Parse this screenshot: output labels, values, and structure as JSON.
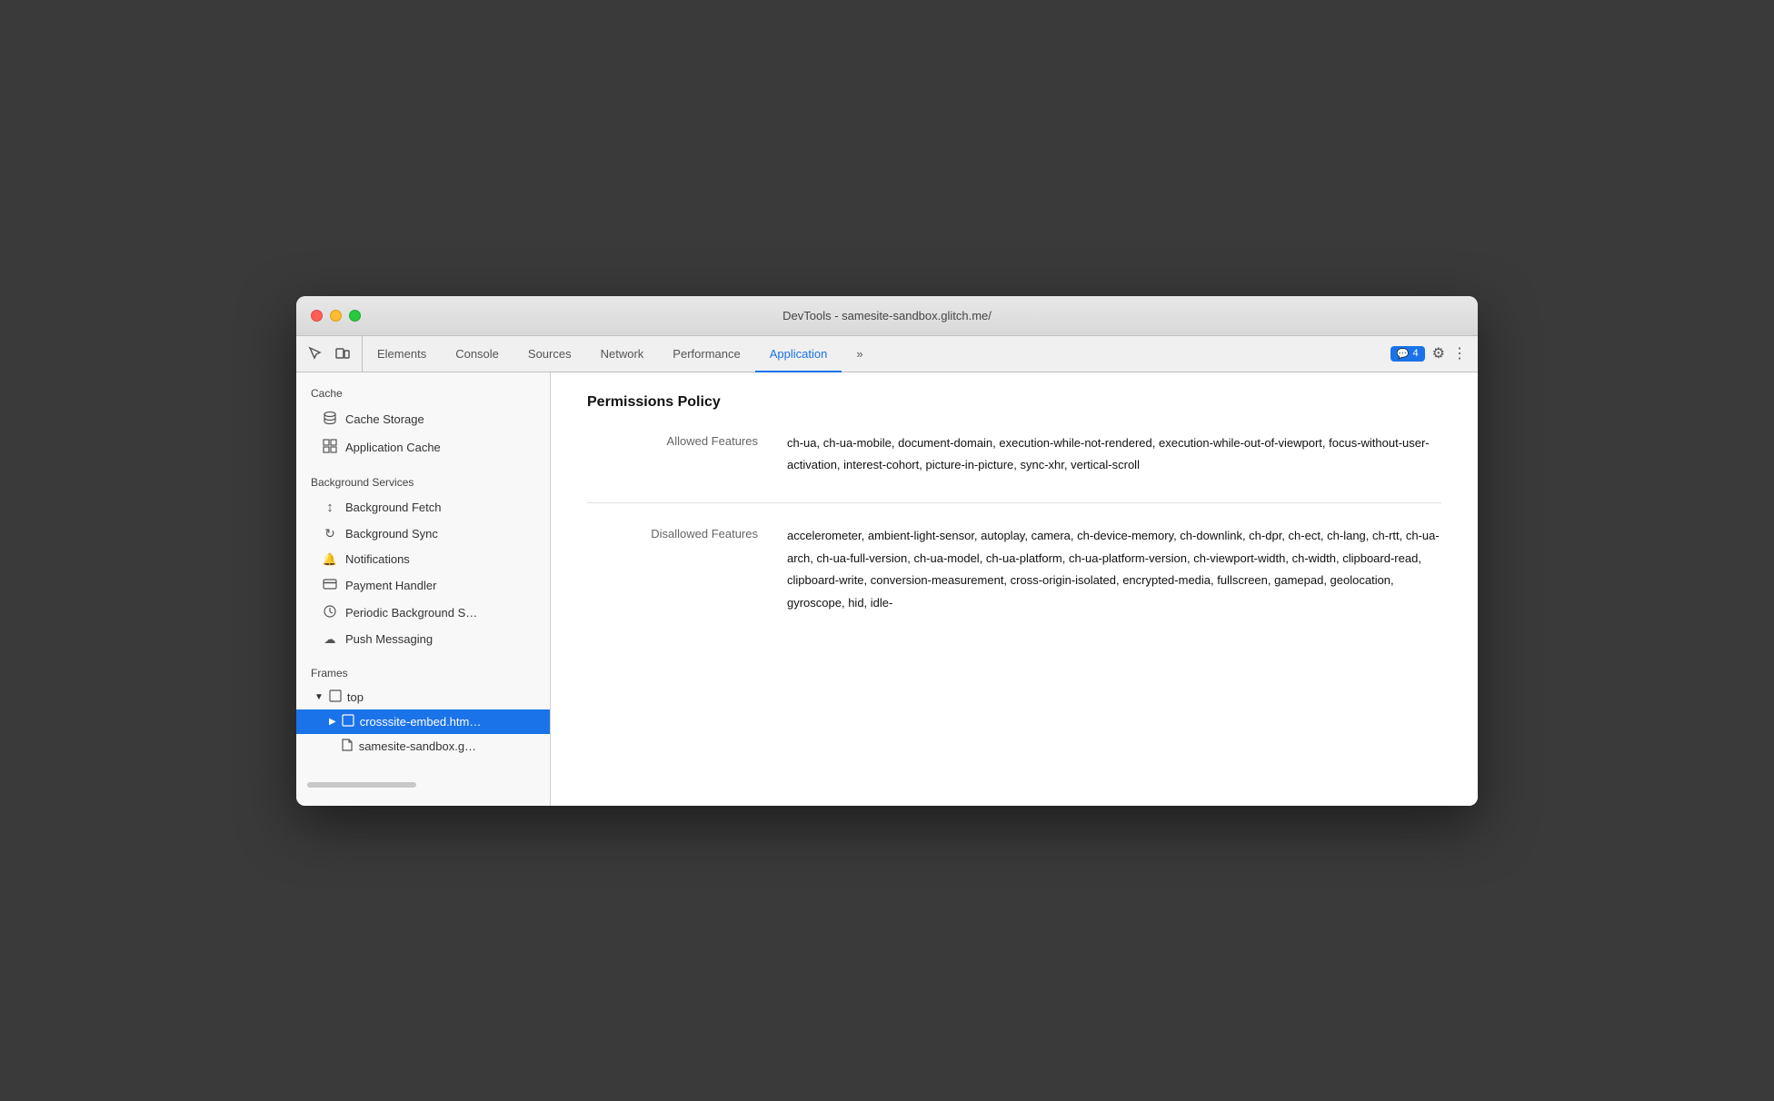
{
  "window": {
    "title": "DevTools - samesite-sandbox.glitch.me/"
  },
  "toolbar": {
    "tabs": [
      {
        "id": "elements",
        "label": "Elements",
        "active": false
      },
      {
        "id": "console",
        "label": "Console",
        "active": false
      },
      {
        "id": "sources",
        "label": "Sources",
        "active": false
      },
      {
        "id": "network",
        "label": "Network",
        "active": false
      },
      {
        "id": "performance",
        "label": "Performance",
        "active": false
      },
      {
        "id": "application",
        "label": "Application",
        "active": true
      }
    ],
    "more_label": "»",
    "notification_count": "4",
    "notification_icon": "💬"
  },
  "sidebar": {
    "sections": [
      {
        "id": "cache",
        "label": "Cache",
        "items": [
          {
            "id": "cache-storage",
            "icon": "🗄",
            "label": "Cache Storage"
          },
          {
            "id": "application-cache",
            "icon": "⊞",
            "label": "Application Cache"
          }
        ]
      },
      {
        "id": "background-services",
        "label": "Background Services",
        "items": [
          {
            "id": "background-fetch",
            "icon": "↕",
            "label": "Background Fetch"
          },
          {
            "id": "background-sync",
            "icon": "↻",
            "label": "Background Sync"
          },
          {
            "id": "notifications",
            "icon": "🔔",
            "label": "Notifications"
          },
          {
            "id": "payment-handler",
            "icon": "🃏",
            "label": "Payment Handler"
          },
          {
            "id": "periodic-background-sync",
            "icon": "🕐",
            "label": "Periodic Background S…"
          },
          {
            "id": "push-messaging",
            "icon": "☁",
            "label": "Push Messaging"
          }
        ]
      },
      {
        "id": "frames",
        "label": "Frames",
        "tree": [
          {
            "id": "top",
            "label": "top",
            "icon": "▢",
            "expanded": true,
            "arrow": "▼",
            "children": [
              {
                "id": "crosssite-embed",
                "label": "crosssite-embed.htm…",
                "icon": "▢",
                "arrow": "▶",
                "selected": true
              },
              {
                "id": "samesite-sandbox",
                "label": "samesite-sandbox.g…",
                "icon": "📄",
                "arrow": ""
              }
            ]
          }
        ]
      }
    ]
  },
  "content": {
    "title": "Permissions Policy",
    "policies": [
      {
        "id": "allowed-features",
        "label": "Allowed Features",
        "value": "ch-ua, ch-ua-mobile, document-domain, execution-while-not-rendered, execution-while-out-of-viewport, focus-without-user-activation, interest-cohort, picture-in-picture, sync-xhr, vertical-scroll"
      },
      {
        "id": "disallowed-features",
        "label": "Disallowed Features",
        "value": "accelerometer, ambient-light-sensor, autoplay, camera, ch-device-memory, ch-downlink, ch-dpr, ch-ect, ch-lang, ch-rtt, ch-ua-arch, ch-ua-full-version, ch-ua-model, ch-ua-platform, ch-ua-platform-version, ch-viewport-width, ch-width, clipboard-read, clipboard-write, conversion-measurement, cross-origin-isolated, encrypted-media, fullscreen, gamepad, geolocation, gyroscope, hid, idle-"
      }
    ]
  }
}
